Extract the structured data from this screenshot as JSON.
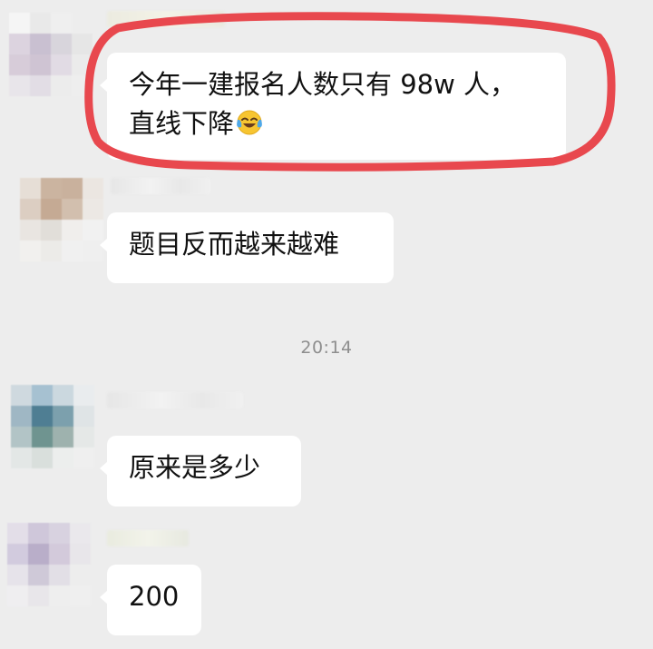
{
  "messages": [
    {
      "text_line1": "今年一建报名人数只有 98w 人，",
      "text_line2": "直线下降",
      "emoji": "crying-laughing-emoji"
    },
    {
      "text": "题目反而越来越难"
    },
    {
      "text": "原来是多少"
    },
    {
      "text": "200"
    }
  ],
  "timestamp": "20:14",
  "colors": {
    "background": "#ededed",
    "bubble": "#ffffff",
    "highlight": "#e8484e",
    "timestamp_text": "#8e8e8e"
  }
}
